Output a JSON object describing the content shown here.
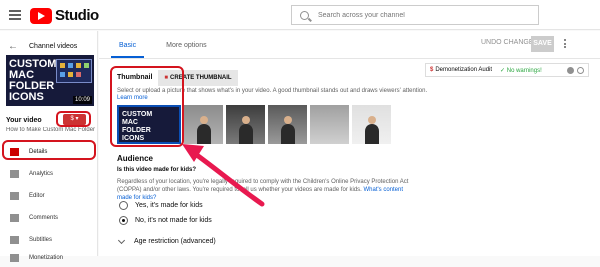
{
  "topbar": {
    "logo_text": "Studio",
    "search_placeholder": "Search across your channel"
  },
  "sidebar": {
    "back_label": "Channel videos",
    "thumb_lines": [
      "CUSTOM",
      "MAC",
      "FOLDER",
      "ICONS"
    ],
    "duration": "10:09",
    "your_video": "Your video",
    "video_title": "How to Make Custom Mac Folder Ic...",
    "items": [
      {
        "label": "Details"
      },
      {
        "label": "Analytics"
      },
      {
        "label": "Editor"
      },
      {
        "label": "Comments"
      },
      {
        "label": "Subtitles"
      },
      {
        "label": "Monetization"
      }
    ]
  },
  "main": {
    "tabs": [
      {
        "label": "Basic"
      },
      {
        "label": "More options"
      }
    ],
    "undo_label": "UNDO CHANGES",
    "save_label": "SAVE",
    "demonetization": {
      "label": "Demonetization Audit",
      "status": "No warnings!"
    },
    "thumbnail": {
      "heading": "Thumbnail",
      "create_label": "CREATE THUMBNAIL",
      "desc": "Select or upload a picture that shows what's in your video. A good thumbnail stands out and draws viewers' attention.",
      "learn_more": "Learn more",
      "big_lines": [
        "CUSTOM",
        "MAC",
        "FOLDER",
        "ICONS"
      ]
    },
    "audience": {
      "heading": "Audience",
      "question": "Is this video made for kids?",
      "paragraph": "Regardless of your location, you're legally required to comply with the Children's Online Privacy Protection Act (COPPA) and/or other laws. You're required to tell us whether your videos are made for kids.",
      "link": "What's content made for kids?",
      "option_yes": "Yes, it's made for kids",
      "option_no": "No, it's not made for kids",
      "age_restriction": "Age restriction (advanced)"
    }
  },
  "colors": {
    "accent": "#065fd4",
    "brand": "#ff0000",
    "highlight": "#d4141e",
    "arrow": "#e8194f"
  }
}
